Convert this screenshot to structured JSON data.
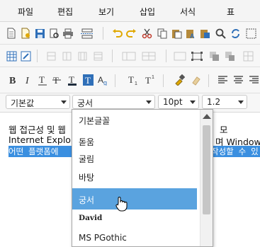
{
  "menubar": {
    "items": [
      "파일",
      "편집",
      "보기",
      "삽입",
      "서식",
      "표"
    ]
  },
  "format_bar": {
    "paragraph_style": "기본값",
    "font_family": "궁서",
    "font_size": "10pt",
    "line_height": "1.2"
  },
  "editor": {
    "line1": "웹 접근성 및 웹",
    "line1_tail": "모",
    "line2": "Internet Explor",
    "line2_tail": "며 Windows",
    "line3": "어떤 플랫폼에",
    "line3_tail": "작성할 수 있"
  },
  "font_dropdown": {
    "items": [
      "기본글꼴",
      "돋움",
      "굴림",
      "바탕",
      "궁서",
      "David",
      "MS PGothic"
    ],
    "selected": "궁서"
  },
  "colors": {
    "selection": "#3a8fe0",
    "dropdown_active": "#5aa3df"
  }
}
